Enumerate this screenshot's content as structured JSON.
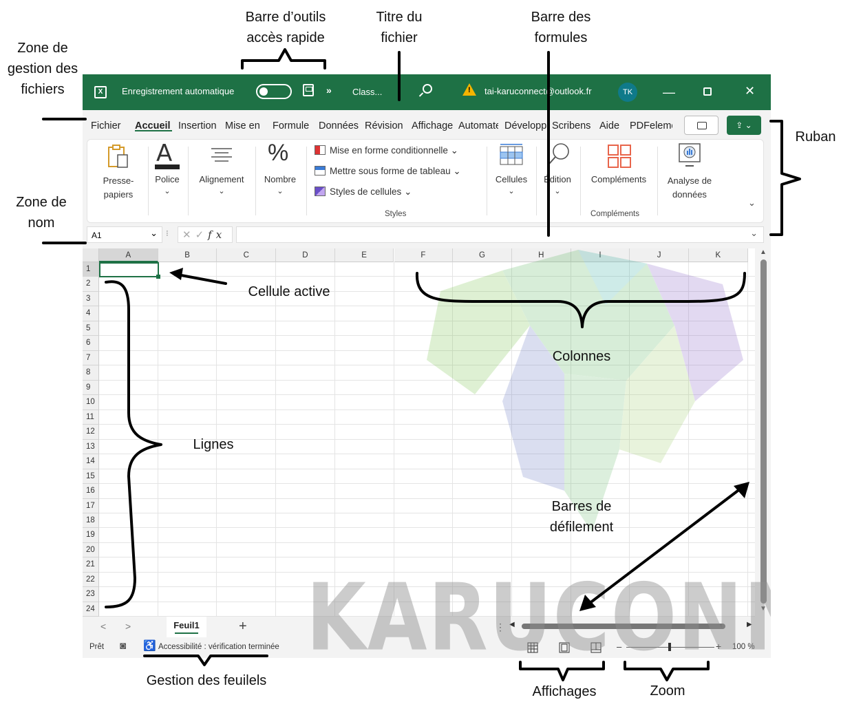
{
  "titlebar": {
    "app_icon": "excel-icon",
    "autosave_label": "Enregistrement automatique",
    "more_label": "»",
    "filename": "Class...",
    "account": "tai-karuconnect@outlook.fr",
    "avatar": "TK",
    "colors": {
      "bar": "#1e7145",
      "warning": "#f5b400",
      "avatar": "#0f7a8a"
    }
  },
  "tabs": [
    "Fichier",
    "Accueil",
    "Insertion",
    "Mise en",
    "Formule",
    "Données",
    "Révision",
    "Affichage",
    "Automate",
    "Développeur",
    "Scribens",
    "Aide",
    "PDFelement"
  ],
  "share_label": "⇪ ⌄",
  "ribbon": {
    "clipboard": "Presse-\npapiers",
    "font": "Police",
    "alignment": "Alignement",
    "number": "Nombre",
    "number_glyph": "%",
    "conditional_format": "Mise en forme conditionnelle",
    "format_table": "Mettre sous forme de tableau",
    "cell_styles": "Styles de cellules",
    "styles_group": "Styles",
    "cells": "Cellules",
    "editing": "Édition",
    "addins": "Compléments",
    "addins_group": "Compléments",
    "analyze": "Analyse de\ndonnées"
  },
  "formula_bar": {
    "name_box": "A1",
    "value": ""
  },
  "grid": {
    "columns": [
      "A",
      "B",
      "C",
      "D",
      "E",
      "F",
      "G",
      "H",
      "I",
      "J",
      "K"
    ],
    "rows": [
      "1",
      "2",
      "3",
      "4",
      "5",
      "6",
      "7",
      "8",
      "9",
      "10",
      "11",
      "12",
      "13",
      "14",
      "15",
      "16",
      "17",
      "18",
      "19",
      "20",
      "21",
      "22",
      "23",
      "24"
    ],
    "active_cell": "A1"
  },
  "sheets": {
    "tabs": [
      "Feuil1"
    ],
    "add": "+",
    "prev": "<",
    "next": ">",
    "more": "⋮"
  },
  "status": {
    "ready": "Prêt",
    "accessibility": "Accessibilité : vérification terminée",
    "zoom_minus": "–",
    "zoom_plus": "+",
    "zoom": "100 %"
  },
  "watermark": "KARUCONNECT",
  "annotations": {
    "qat": "Barre d’outils\naccès rapide",
    "title": "Titre du\nfichier",
    "formula": "Barre des\nformules",
    "file_mgmt": "Zone de\ngestion des\nfichiers",
    "ribbon": "Ruban",
    "name_zone": "Zone de\nnom",
    "active_cell": "Cellule active",
    "columns": "Colonnes",
    "rows": "Lignes",
    "scrollbars": "Barres de\ndéfilement",
    "sheets": "Gestion des feuilels",
    "views": "Affichages",
    "zoom": "Zoom"
  }
}
